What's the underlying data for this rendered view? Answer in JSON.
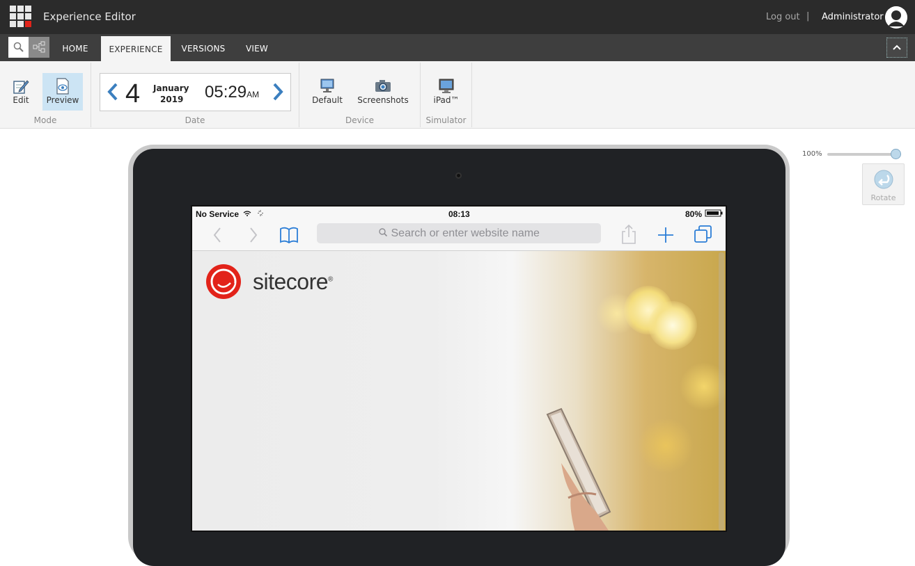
{
  "app": {
    "title": "Experience Editor"
  },
  "user": {
    "logout_label": "Log out",
    "separator": "|",
    "name": "Administrator"
  },
  "tabs": [
    {
      "label": "HOME"
    },
    {
      "label": "EXPERIENCE"
    },
    {
      "label": "VERSIONS"
    },
    {
      "label": "VIEW"
    }
  ],
  "ribbon": {
    "mode": {
      "label": "Mode",
      "edit": "Edit",
      "preview": "Preview"
    },
    "date": {
      "label": "Date",
      "day": "4",
      "month": "January",
      "year": "2019",
      "time": "05:29",
      "ampm": "AM"
    },
    "device": {
      "label": "Device",
      "default": "Default",
      "screenshots": "Screenshots"
    },
    "simulator": {
      "label": "Simulator",
      "ipad": "iPad™"
    }
  },
  "canvas": {
    "zoom_label": "100%",
    "zoom_level": 1.0,
    "rotate_label": "Rotate"
  },
  "device_screen": {
    "carrier": "No Service",
    "clock": "08:13",
    "battery": "80%",
    "url_placeholder": "Search or enter website name",
    "brand": "sitecore",
    "brand_mark": "®"
  },
  "colors": {
    "accent": "#3b7fbf",
    "brand_red": "#e2231a",
    "active_button": "#cce4f4"
  }
}
